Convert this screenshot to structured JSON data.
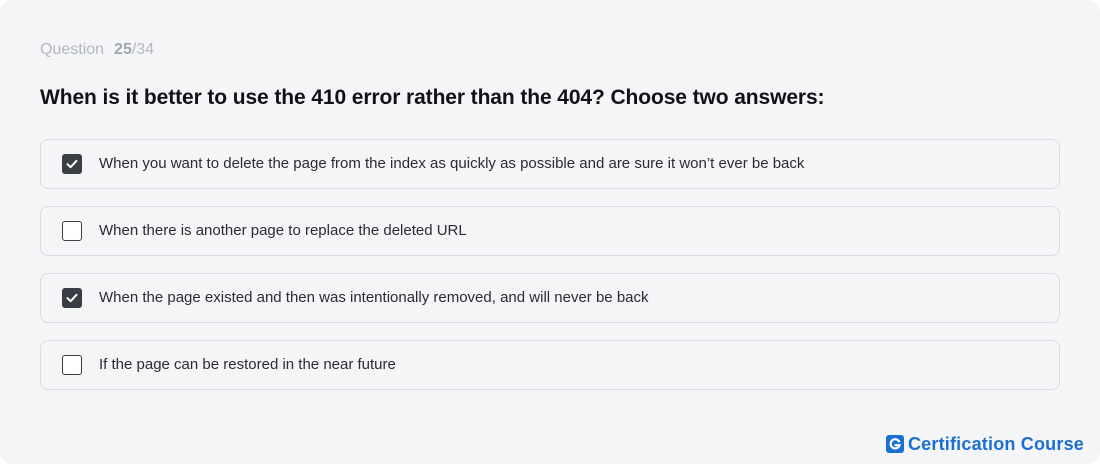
{
  "question": {
    "counter_label": "Question",
    "current": "25",
    "separator": "/",
    "total": "34",
    "title": "When is it better to use the 410 error rather than the 404? Choose two answers:"
  },
  "options": [
    {
      "label": "When you want to delete the page from the index as quickly as possible and are sure it won’t ever be back",
      "checked": true
    },
    {
      "label": "When there is another page to replace the deleted URL",
      "checked": false
    },
    {
      "label": "When the page existed and then was intentionally removed, and will never be back",
      "checked": true
    },
    {
      "label": "If the page can be restored in the near future",
      "checked": false
    }
  ],
  "brand": {
    "logo_letter": "G",
    "name": "Certification Course",
    "color": "#1b6fd1"
  },
  "colors": {
    "checkbox_checked": "#3a3d44",
    "background": "#f4f5f7"
  }
}
